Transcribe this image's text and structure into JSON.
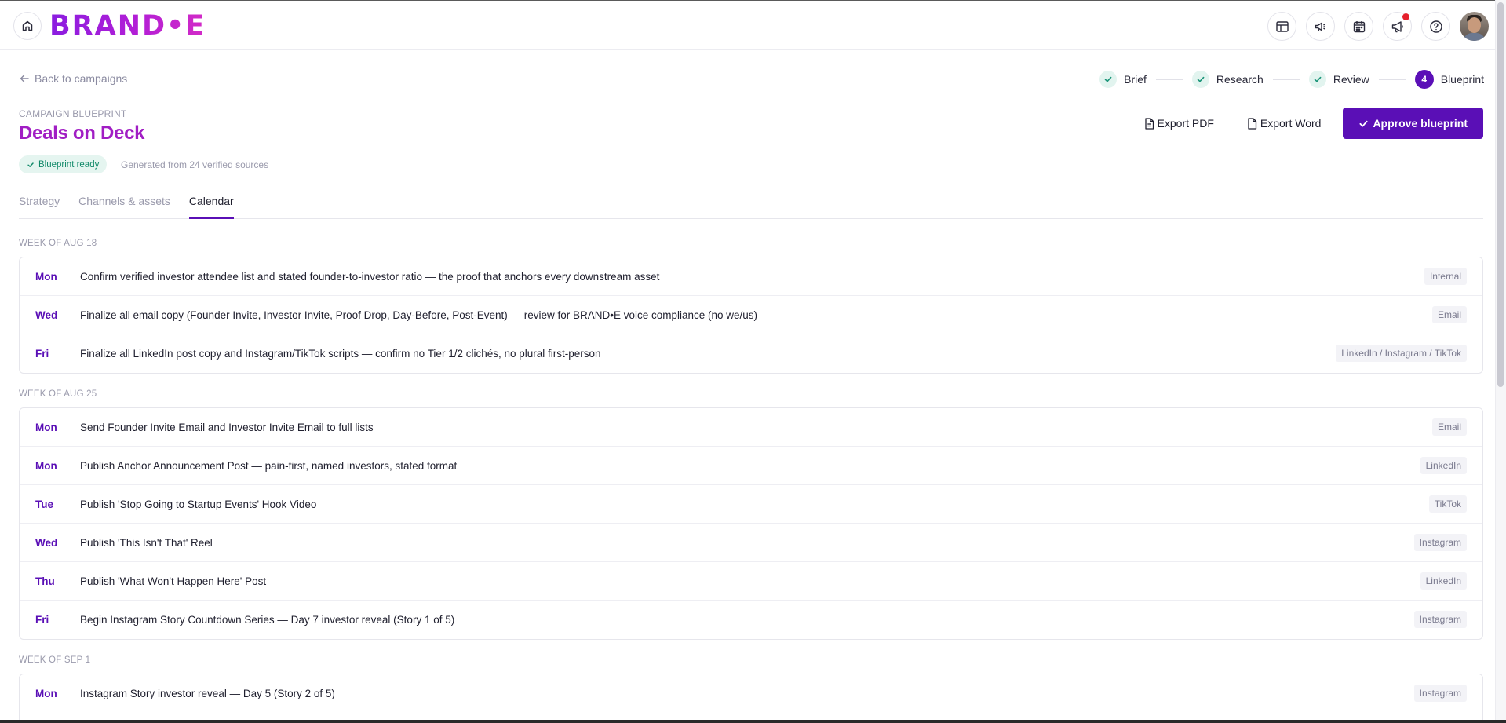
{
  "header": {
    "logo_text": "BRAND•E",
    "icons": [
      "layout-icon",
      "megaphone-sparkle-icon",
      "calendar-icon",
      "announcement-icon",
      "help-icon"
    ]
  },
  "nav": {
    "back_label": "Back to campaigns",
    "steps": [
      {
        "label": "Brief",
        "state": "done"
      },
      {
        "label": "Research",
        "state": "done"
      },
      {
        "label": "Review",
        "state": "done"
      },
      {
        "label": "Blueprint",
        "state": "current",
        "number": "4"
      }
    ]
  },
  "page": {
    "eyebrow": "CAMPAIGN BLUEPRINT",
    "title": "Deals on Deck",
    "status_badge": "Blueprint ready",
    "sources_note": "Generated from 24 verified sources"
  },
  "actions": {
    "export_pdf": "Export PDF",
    "export_word": "Export Word",
    "approve": "Approve blueprint"
  },
  "tabs": [
    {
      "label": "Strategy",
      "active": false
    },
    {
      "label": "Channels & assets",
      "active": false
    },
    {
      "label": "Calendar",
      "active": true
    }
  ],
  "calendar": {
    "weeks": [
      {
        "label": "WEEK OF AUG 18",
        "items": [
          {
            "day": "Mon",
            "task": "Confirm verified investor attendee list and stated founder-to-investor ratio — the proof that anchors every downstream asset",
            "channel": "Internal"
          },
          {
            "day": "Wed",
            "task": "Finalize all email copy (Founder Invite, Investor Invite, Proof Drop, Day-Before, Post-Event) — review for BRAND•E voice compliance (no we/us)",
            "channel": "Email"
          },
          {
            "day": "Fri",
            "task": "Finalize all LinkedIn post copy and Instagram/TikTok scripts — confirm no Tier 1/2 clichés, no plural first-person",
            "channel": "LinkedIn / Instagram / TikTok"
          }
        ]
      },
      {
        "label": "WEEK OF AUG 25",
        "items": [
          {
            "day": "Mon",
            "task": "Send Founder Invite Email and Investor Invite Email to full lists",
            "channel": "Email"
          },
          {
            "day": "Mon",
            "task": "Publish Anchor Announcement Post — pain-first, named investors, stated format",
            "channel": "LinkedIn"
          },
          {
            "day": "Tue",
            "task": "Publish 'Stop Going to Startup Events' Hook Video",
            "channel": "TikTok"
          },
          {
            "day": "Wed",
            "task": "Publish 'This Isn't That' Reel",
            "channel": "Instagram"
          },
          {
            "day": "Thu",
            "task": "Publish 'What Won't Happen Here' Post",
            "channel": "LinkedIn"
          },
          {
            "day": "Fri",
            "task": "Begin Instagram Story Countdown Series — Day 7 investor reveal (Story 1 of 5)",
            "channel": "Instagram"
          }
        ]
      },
      {
        "label": "WEEK OF SEP 1",
        "items": [
          {
            "day": "Mon",
            "task": "Instagram Story investor reveal — Day 5 (Story 2 of 5)",
            "channel": "Instagram"
          }
        ]
      }
    ]
  },
  "colors": {
    "brand_purple": "#5a0fb6",
    "title_magenta": "#a11ec4",
    "success_green": "#138a6a",
    "notification_red": "#e5202c"
  }
}
